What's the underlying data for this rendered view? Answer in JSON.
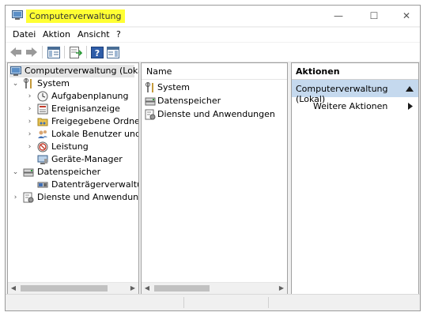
{
  "window": {
    "title": "Computerverwaltung",
    "controls": {
      "minimize": "—",
      "maximize": "☐",
      "close": "✕"
    }
  },
  "menu": [
    "Datei",
    "Aktion",
    "Ansicht",
    "?"
  ],
  "toolbar": {
    "icons": [
      "back-icon",
      "forward-icon",
      "show-hide-tree-icon",
      "export-list-icon",
      "help-icon",
      "show-hide-action-pane-icon"
    ]
  },
  "tree": {
    "root": "Computerverwaltung (Lokal)",
    "system": "System",
    "system_items": [
      "Aufgabenplanung",
      "Ereignisanzeige",
      "Freigegebene Ordner",
      "Lokale Benutzer und Gr",
      "Leistung",
      "Geräte-Manager"
    ],
    "storage": "Datenspeicher",
    "storage_items": [
      "Datenträgerverwaltung"
    ],
    "services": "Dienste und Anwendungen"
  },
  "list": {
    "column": "Name",
    "items": [
      "System",
      "Datenspeicher",
      "Dienste und Anwendungen"
    ]
  },
  "actions": {
    "header": "Aktionen",
    "section": "Computerverwaltung (Lokal)",
    "more": "Weitere Aktionen"
  },
  "colors": {
    "title_highlight": "#ffff33",
    "action_section_bg": "#c5d9ee",
    "selection_bg": "#e5e5e5"
  }
}
